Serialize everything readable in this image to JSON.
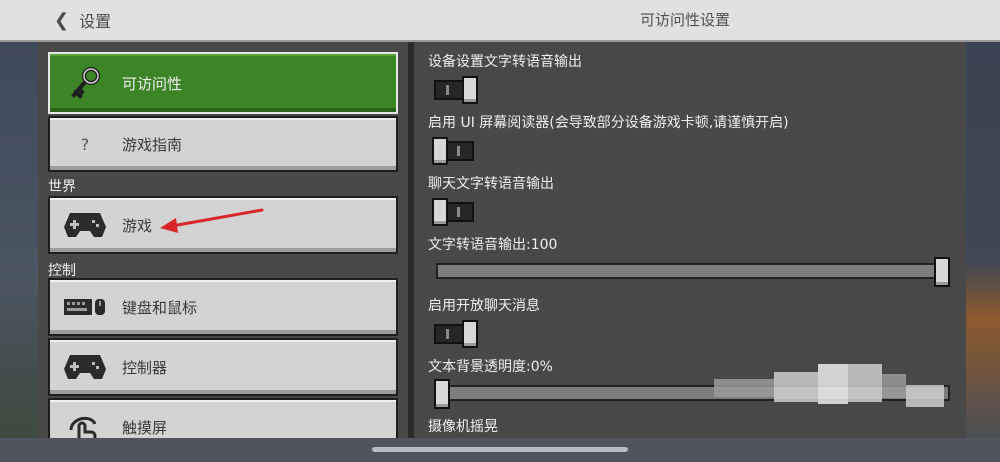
{
  "header": {
    "back_label": "设置",
    "title": "可访问性设置"
  },
  "sidebar": {
    "items": [
      {
        "label": "可访问性",
        "icon": "key-icon",
        "active": true
      },
      {
        "label": "游戏指南",
        "icon": "question-icon",
        "active": false
      }
    ],
    "sections": [
      {
        "title": "世界",
        "items": [
          {
            "label": "游戏",
            "icon": "gamepad-icon"
          }
        ]
      },
      {
        "title": "控制",
        "items": [
          {
            "label": "键盘和鼠标",
            "icon": "keyboard-mouse-icon"
          },
          {
            "label": "控制器",
            "icon": "controller-icon"
          },
          {
            "label": "触摸屏",
            "icon": "touch-icon"
          }
        ]
      }
    ],
    "question_glyph": "?"
  },
  "settings": {
    "tts_device": {
      "label": "设备设置文字转语音输出",
      "on": true
    },
    "ui_reader": {
      "label": "启用 UI 屏幕阅读器(会导致部分设备游戏卡顿,请谨慎开启)",
      "on": false
    },
    "chat_tts": {
      "label": "聊天文字转语音输出",
      "on": false
    },
    "tts_volume": {
      "label": "文字转语音输出:100",
      "value": 100
    },
    "open_chat": {
      "label": "启用开放聊天消息",
      "on": true
    },
    "text_bg_opacity": {
      "label": "文本背景透明度:0%",
      "value": 0
    },
    "camera_shake": {
      "label": "摄像机摇晃"
    }
  },
  "annotation": {
    "color": "#d9262b",
    "points_to": "游戏"
  },
  "colors": {
    "active": "#3c8527",
    "button": "#d3d3d3",
    "panel": "#484848",
    "topbar": "#e1e1e1"
  }
}
